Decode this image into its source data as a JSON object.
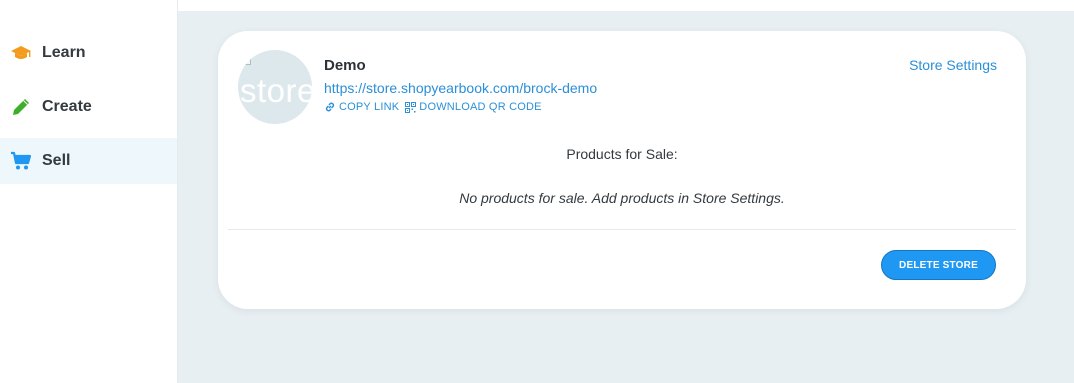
{
  "sidebar": {
    "items": [
      {
        "label": "Learn",
        "icon": "graduation-cap-icon",
        "icon_color": "#f29b1d",
        "active": false
      },
      {
        "label": "Create",
        "icon": "pencil-icon",
        "icon_color": "#3fae2a",
        "active": false
      },
      {
        "label": "Sell",
        "icon": "shopping-cart-icon",
        "icon_color": "#1e98f2",
        "active": true
      }
    ]
  },
  "store": {
    "avatar_text": "store",
    "name": "Demo",
    "url": "https://store.shopyearbook.com/brock-demo",
    "copy_link_label": "COPY LINK",
    "qr_label": "DOWNLOAD QR CODE",
    "settings_label": "Store Settings",
    "products_heading": "Products for Sale:",
    "products_empty": "No products for sale. Add products in Store Settings.",
    "delete_label": "DELETE STORE"
  },
  "colors": {
    "accent": "#1e98f2",
    "link": "#2b8fd8",
    "background": "#e8eff3",
    "active_nav": "#eef8fc"
  }
}
